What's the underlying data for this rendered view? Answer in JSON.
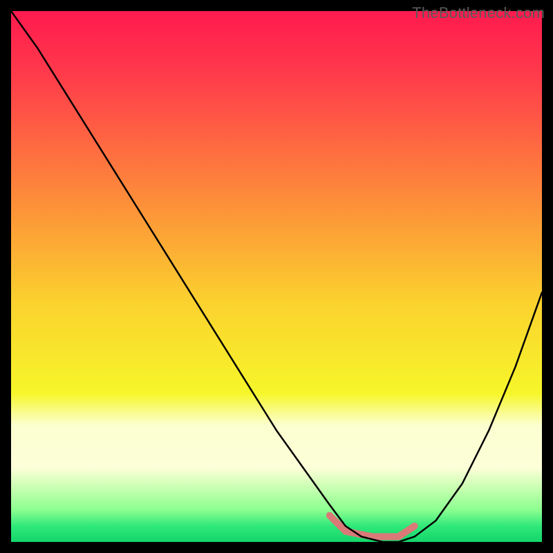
{
  "watermark": "TheBottleneck.com",
  "chart_data": {
    "type": "line",
    "title": "",
    "xlabel": "",
    "ylabel": "",
    "xlim": [
      0,
      100
    ],
    "ylim": [
      0,
      100
    ],
    "background_gradient": {
      "stops": [
        {
          "pos": 0.0,
          "color": "#ff1a4e"
        },
        {
          "pos": 0.12,
          "color": "#ff3b4b"
        },
        {
          "pos": 0.35,
          "color": "#fd8b3a"
        },
        {
          "pos": 0.55,
          "color": "#fbd22e"
        },
        {
          "pos": 0.72,
          "color": "#f6f62a"
        },
        {
          "pos": 0.78,
          "color": "#fbffd0"
        },
        {
          "pos": 0.86,
          "color": "#fdffd8"
        },
        {
          "pos": 0.9,
          "color": "#c6ffb0"
        },
        {
          "pos": 0.94,
          "color": "#8bff90"
        },
        {
          "pos": 0.97,
          "color": "#30e87a"
        },
        {
          "pos": 1.0,
          "color": "#14d66a"
        }
      ]
    },
    "series": [
      {
        "name": "bottleneck-curve",
        "color": "#000000",
        "stroke_width": 2.5,
        "x": [
          0,
          5,
          10,
          15,
          20,
          25,
          30,
          35,
          40,
          45,
          50,
          55,
          60,
          63,
          66,
          70,
          73,
          76,
          80,
          85,
          90,
          95,
          100
        ],
        "values": [
          100,
          93,
          85,
          77,
          69,
          61,
          53,
          45,
          37,
          29,
          21,
          14,
          7,
          3,
          1,
          0,
          0,
          1,
          4,
          11,
          21,
          33,
          47
        ]
      }
    ],
    "annotations": [
      {
        "name": "trough-marker",
        "type": "segment",
        "color": "#d97a78",
        "stroke_width": 10,
        "points": [
          {
            "x": 60,
            "y": 5
          },
          {
            "x": 63,
            "y": 2
          },
          {
            "x": 68,
            "y": 1
          },
          {
            "x": 73,
            "y": 1
          },
          {
            "x": 76,
            "y": 3
          }
        ]
      }
    ]
  }
}
